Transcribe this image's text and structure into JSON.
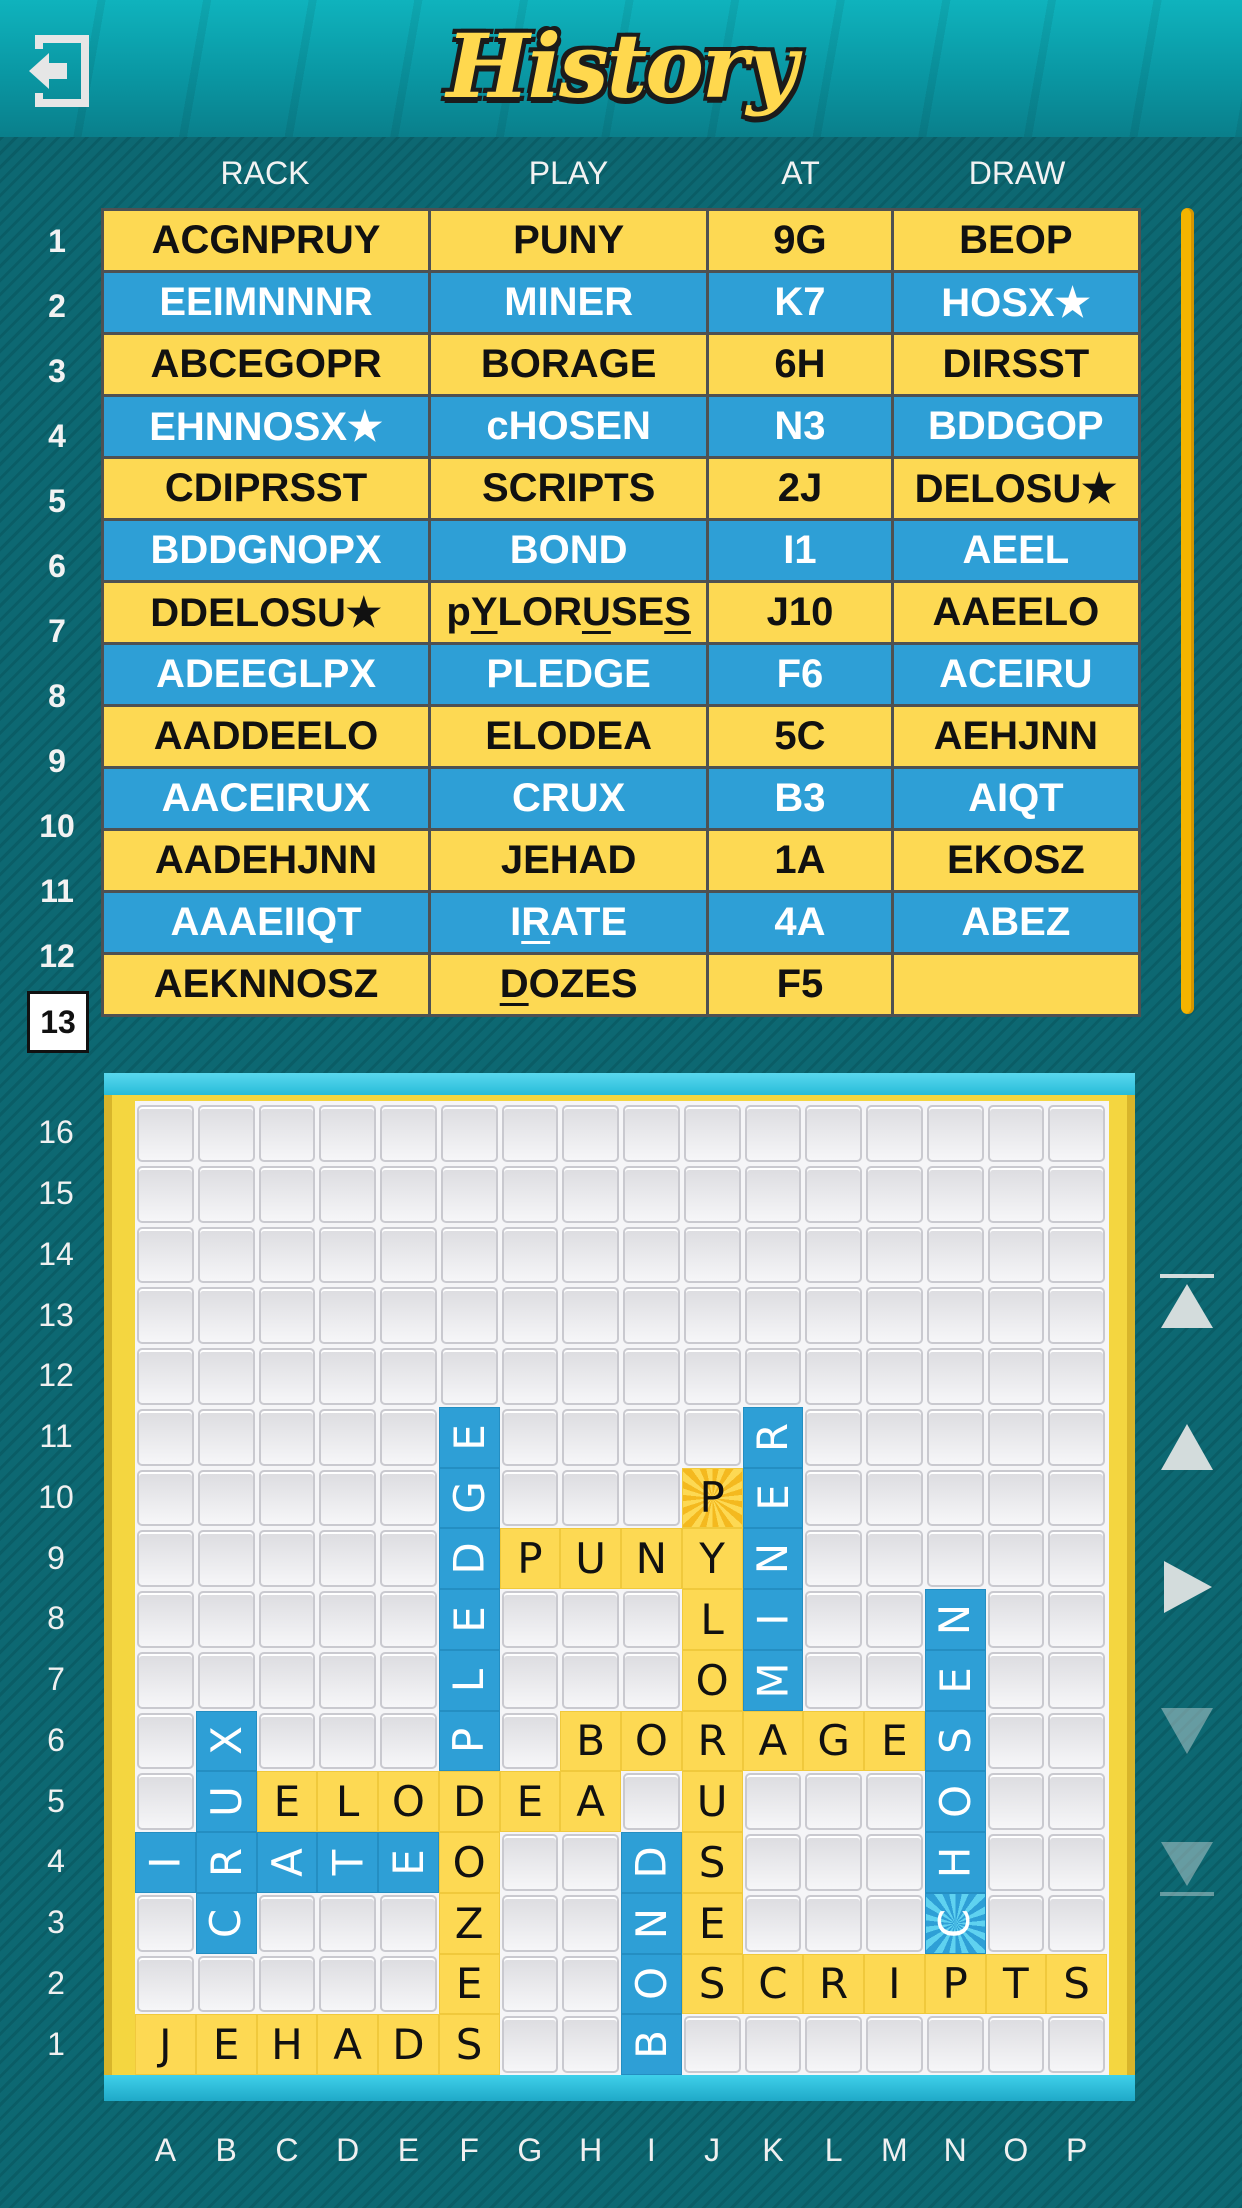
{
  "header": {
    "title": "History",
    "back_icon": "exit-arrow-icon"
  },
  "colors": {
    "yellow": "#fdd953",
    "blue": "#2e9fd6",
    "background": "#0d6872",
    "scrollbar": "#f4b400"
  },
  "columns": [
    "RACK",
    "PLAY",
    "AT",
    "DRAW"
  ],
  "history": [
    {
      "num": "1",
      "color": "yellow",
      "rack": "ACGNPRUY",
      "play": "PUNY",
      "underline": [],
      "at": "9G",
      "draw": "BEOP"
    },
    {
      "num": "2",
      "color": "blue",
      "rack": "EEIMNNNR",
      "play": "MINER",
      "underline": [],
      "at": "K7",
      "draw": "HOSX★"
    },
    {
      "num": "3",
      "color": "yellow",
      "rack": "ABCEGOPR",
      "play": "BORAGE",
      "underline": [],
      "at": "6H",
      "draw": "DIRSST"
    },
    {
      "num": "4",
      "color": "blue",
      "rack": "EHNNOSX★",
      "play": "cHOSEN",
      "underline": [],
      "at": "N3",
      "draw": "BDDGOP"
    },
    {
      "num": "5",
      "color": "yellow",
      "rack": "CDIPRSST",
      "play": "SCRIPTS",
      "underline": [],
      "at": "2J",
      "draw": "DELOSU★"
    },
    {
      "num": "6",
      "color": "blue",
      "rack": "BDDGNOPX",
      "play": "BOND",
      "underline": [],
      "at": "I1",
      "draw": "AEEL"
    },
    {
      "num": "7",
      "color": "yellow",
      "rack": "DDELOSU★",
      "play": "pYLORUSES",
      "underline": [
        1,
        5,
        8
      ],
      "at": "J10",
      "draw": "AAEELO"
    },
    {
      "num": "8",
      "color": "blue",
      "rack": "ADEEGLPX",
      "play": "PLEDGE",
      "underline": [],
      "at": "F6",
      "draw": "ACEIRU"
    },
    {
      "num": "9",
      "color": "yellow",
      "rack": "AADDEELO",
      "play": "ELODEA",
      "underline": [],
      "at": "5C",
      "draw": "AEHJNN"
    },
    {
      "num": "10",
      "color": "blue",
      "rack": "AACEIRUX",
      "play": "CRUX",
      "underline": [],
      "at": "B3",
      "draw": "AIQT"
    },
    {
      "num": "11",
      "color": "yellow",
      "rack": "AADEHJNN",
      "play": "JEHAD",
      "underline": [],
      "at": "1A",
      "draw": "EKOSZ"
    },
    {
      "num": "12",
      "color": "blue",
      "rack": "AAAEIIQT",
      "play": "IRATE",
      "underline": [
        1
      ],
      "at": "4A",
      "draw": "ABEZ"
    },
    {
      "num": "13",
      "color": "yellow",
      "rack": "AEKNNOSZ",
      "play": "DOZES",
      "underline": [
        0
      ],
      "at": "F5",
      "draw": "",
      "current": true
    }
  ],
  "board": {
    "columns": [
      "A",
      "B",
      "C",
      "D",
      "E",
      "F",
      "G",
      "H",
      "I",
      "J",
      "K",
      "L",
      "M",
      "N",
      "O",
      "P"
    ],
    "rows": [
      "16",
      "15",
      "14",
      "13",
      "12",
      "11",
      "10",
      "9",
      "8",
      "7",
      "6",
      "5",
      "4",
      "3",
      "2",
      "1"
    ],
    "tiles": [
      {
        "cell": "A1",
        "letter": "J",
        "color": "yellow"
      },
      {
        "cell": "B1",
        "letter": "E",
        "color": "yellow"
      },
      {
        "cell": "C1",
        "letter": "H",
        "color": "yellow"
      },
      {
        "cell": "D1",
        "letter": "A",
        "color": "yellow"
      },
      {
        "cell": "E1",
        "letter": "D",
        "color": "yellow"
      },
      {
        "cell": "F1",
        "letter": "S",
        "color": "yellow"
      },
      {
        "cell": "F2",
        "letter": "E",
        "color": "yellow"
      },
      {
        "cell": "F3",
        "letter": "Z",
        "color": "yellow"
      },
      {
        "cell": "F4",
        "letter": "O",
        "color": "yellow"
      },
      {
        "cell": "J2",
        "letter": "S",
        "color": "yellow"
      },
      {
        "cell": "K2",
        "letter": "C",
        "color": "yellow"
      },
      {
        "cell": "L2",
        "letter": "R",
        "color": "yellow"
      },
      {
        "cell": "M2",
        "letter": "I",
        "color": "yellow"
      },
      {
        "cell": "N2",
        "letter": "P",
        "color": "yellow"
      },
      {
        "cell": "O2",
        "letter": "T",
        "color": "yellow"
      },
      {
        "cell": "P2",
        "letter": "S",
        "color": "yellow"
      },
      {
        "cell": "J3",
        "letter": "E",
        "color": "yellow"
      },
      {
        "cell": "J4",
        "letter": "S",
        "color": "yellow"
      },
      {
        "cell": "J5",
        "letter": "U",
        "color": "yellow"
      },
      {
        "cell": "J6",
        "letter": "R",
        "color": "yellow"
      },
      {
        "cell": "J7",
        "letter": "O",
        "color": "yellow"
      },
      {
        "cell": "J8",
        "letter": "L",
        "color": "yellow"
      },
      {
        "cell": "J9",
        "letter": "Y",
        "color": "yellow"
      },
      {
        "cell": "J10",
        "letter": "P",
        "color": "yellow",
        "special": true
      },
      {
        "cell": "C5",
        "letter": "E",
        "color": "yellow"
      },
      {
        "cell": "D5",
        "letter": "L",
        "color": "yellow"
      },
      {
        "cell": "E5",
        "letter": "O",
        "color": "yellow"
      },
      {
        "cell": "F5",
        "letter": "D",
        "color": "yellow"
      },
      {
        "cell": "G5",
        "letter": "E",
        "color": "yellow"
      },
      {
        "cell": "H5",
        "letter": "A",
        "color": "yellow"
      },
      {
        "cell": "H6",
        "letter": "B",
        "color": "yellow"
      },
      {
        "cell": "I6",
        "letter": "O",
        "color": "yellow"
      },
      {
        "cell": "K6",
        "letter": "A",
        "color": "yellow"
      },
      {
        "cell": "L6",
        "letter": "G",
        "color": "yellow"
      },
      {
        "cell": "M6",
        "letter": "E",
        "color": "yellow"
      },
      {
        "cell": "G9",
        "letter": "P",
        "color": "yellow"
      },
      {
        "cell": "H9",
        "letter": "U",
        "color": "yellow"
      },
      {
        "cell": "I9",
        "letter": "N",
        "color": "yellow"
      },
      {
        "cell": "A4",
        "letter": "I",
        "color": "blue"
      },
      {
        "cell": "B4",
        "letter": "R",
        "color": "blue"
      },
      {
        "cell": "C4",
        "letter": "A",
        "color": "blue"
      },
      {
        "cell": "D4",
        "letter": "T",
        "color": "blue"
      },
      {
        "cell": "E4",
        "letter": "E",
        "color": "blue"
      },
      {
        "cell": "B3",
        "letter": "C",
        "color": "blue"
      },
      {
        "cell": "B5",
        "letter": "U",
        "color": "blue"
      },
      {
        "cell": "B6",
        "letter": "X",
        "color": "blue"
      },
      {
        "cell": "F6",
        "letter": "P",
        "color": "blue"
      },
      {
        "cell": "F7",
        "letter": "L",
        "color": "blue"
      },
      {
        "cell": "F8",
        "letter": "E",
        "color": "blue"
      },
      {
        "cell": "F9",
        "letter": "D",
        "color": "blue"
      },
      {
        "cell": "F10",
        "letter": "G",
        "color": "blue"
      },
      {
        "cell": "F11",
        "letter": "E",
        "color": "blue"
      },
      {
        "cell": "K7",
        "letter": "M",
        "color": "blue"
      },
      {
        "cell": "K8",
        "letter": "I",
        "color": "blue"
      },
      {
        "cell": "K9",
        "letter": "N",
        "color": "blue"
      },
      {
        "cell": "K10",
        "letter": "E",
        "color": "blue"
      },
      {
        "cell": "K11",
        "letter": "R",
        "color": "blue"
      },
      {
        "cell": "N3",
        "letter": "C",
        "color": "blue",
        "special": true
      },
      {
        "cell": "N4",
        "letter": "H",
        "color": "blue"
      },
      {
        "cell": "N5",
        "letter": "O",
        "color": "blue"
      },
      {
        "cell": "N6",
        "letter": "S",
        "color": "blue"
      },
      {
        "cell": "N7",
        "letter": "E",
        "color": "blue"
      },
      {
        "cell": "N8",
        "letter": "N",
        "color": "blue"
      },
      {
        "cell": "I1",
        "letter": "B",
        "color": "blue"
      },
      {
        "cell": "I2",
        "letter": "O",
        "color": "blue"
      },
      {
        "cell": "I3",
        "letter": "N",
        "color": "blue"
      },
      {
        "cell": "I4",
        "letter": "D",
        "color": "blue"
      }
    ]
  },
  "nav": [
    {
      "icon": "skip-to-first-icon",
      "enabled": true
    },
    {
      "icon": "previous-icon",
      "enabled": true
    },
    {
      "icon": "play-icon",
      "enabled": true
    },
    {
      "icon": "next-icon",
      "enabled": false
    },
    {
      "icon": "skip-to-last-icon",
      "enabled": false
    }
  ]
}
